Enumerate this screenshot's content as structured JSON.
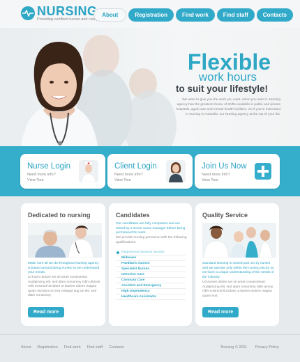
{
  "brand": {
    "name": "NURSING",
    "tagline": "Providing certified nurses and caregivers"
  },
  "nav": {
    "items": [
      "About",
      "Registration",
      "Find work",
      "Find staff",
      "Contacts"
    ],
    "active": "About"
  },
  "hero": {
    "line1": "Flexible",
    "line2": "work hours",
    "line3": "to suit your lifestyle!",
    "text": "We want to give you the work you want, when you want it. Nursing agency has the greatest choice of shifts available in public and private hospitals, aged care and mental health facilities. So if you're interested in nursing in Australia, our Nursing agency at the top of your list."
  },
  "cards": [
    {
      "title": "Nurse Login",
      "sub": "Need more info?",
      "link": "View Tour",
      "icon": "nurse-avatar-icon"
    },
    {
      "title": "Client Login",
      "sub": "Need more info?",
      "link": "View Tour",
      "icon": "client-avatar-icon"
    },
    {
      "title": "Join Us Now",
      "sub": "Need more info?",
      "link": "View Tour",
      "icon": "plus-icon"
    }
  ],
  "panels": {
    "dedicated": {
      "title": "Dedicated to nursing",
      "blue": "Make sure all we do throughout Nursing agency is based around being nurses so we understand your needs.",
      "grey": "Ut lorem dolore set sit amet consectetur. Audipiscing elit, sed diam nonummy nibh ultrices velit eusmod tincidunt ut laoreet dolore magna quam tincidunt ut erat volutpat aug ue elit, sed diam nonummy.",
      "button": "Read more"
    },
    "candidates": {
      "title": "Candidates",
      "blue": "Our candidates are fully competent and are tested by a senior nurse manager before being put forward for work.",
      "grey": "We provide nursing personnel with the following qualifications:",
      "items": [
        "Registered General Nurses",
        "Midwives",
        "Paediatric Nurses",
        "Specialist Nurses",
        "Intensive Care",
        "Coronary Care",
        "Accident and Emergency",
        "High Dependency",
        "Healthcare Assistants"
      ]
    },
    "quality": {
      "title": "Quality Service",
      "blue": "Standard Nursing is owned and run by nurses and we operate only within the nursing sector so we have a unique understanding of the needs of the industry.",
      "grey": "Ut laoreet dolore set sit amet consectetuer. Audipiscing elit, sed diam nonummy nibh ammy nibh euismod tincidunt ut laoreet dolore magna quam erat.",
      "button": "Read more"
    }
  },
  "footer": {
    "links": [
      "About",
      "Registration",
      "Find work",
      "Find staff",
      "Contacts"
    ],
    "copyright": "Nursing © 2011",
    "policy": "Privacy Policy"
  },
  "colors": {
    "accent": "#2ba3c3",
    "band": "#35aecb",
    "background": "#e6eaed"
  }
}
